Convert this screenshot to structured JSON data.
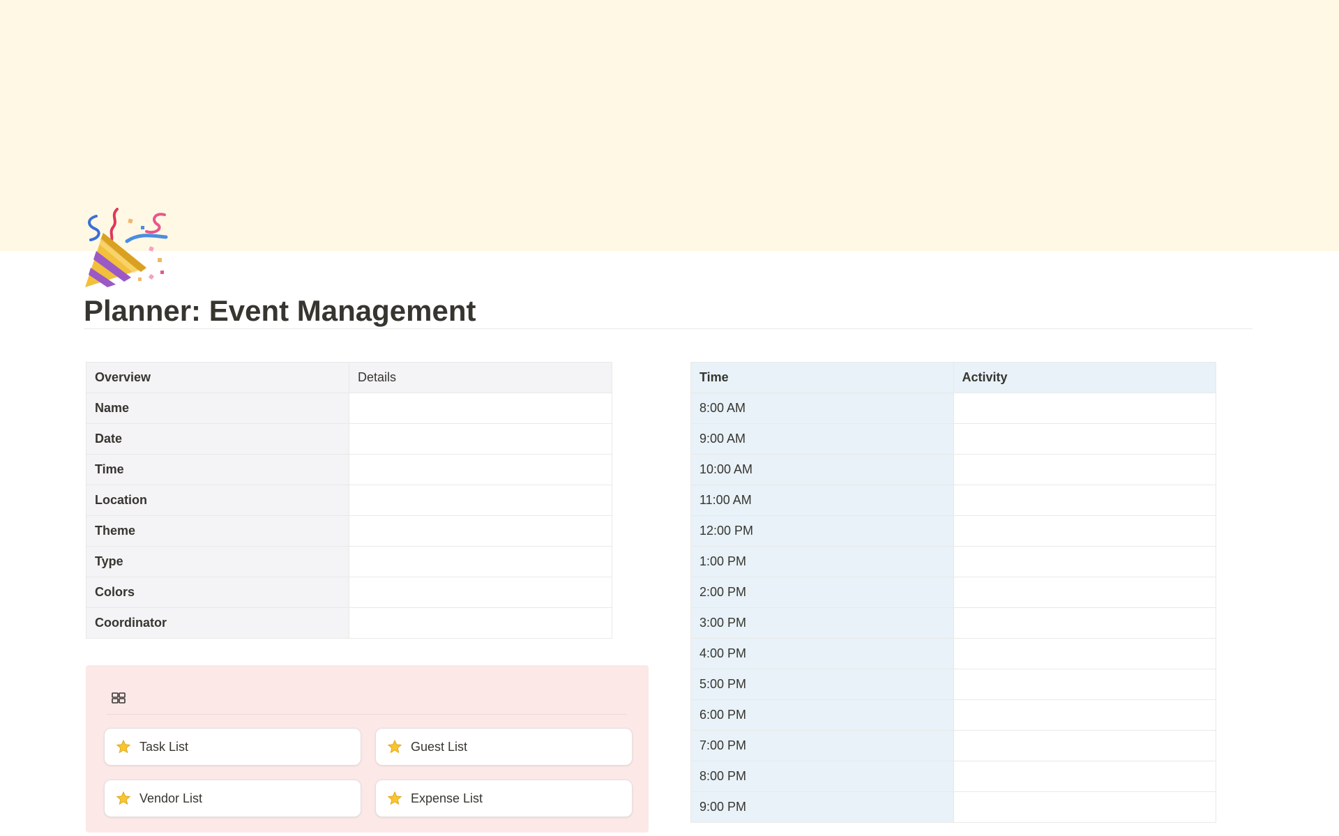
{
  "page": {
    "title": "Planner: Event Management",
    "icon": "party-popper-icon",
    "cover_color": "#fff8e4"
  },
  "overview_table": {
    "headers": [
      "Overview",
      "Details"
    ],
    "rows": [
      {
        "label": "Name",
        "value": ""
      },
      {
        "label": "Date",
        "value": ""
      },
      {
        "label": "Time",
        "value": ""
      },
      {
        "label": "Location",
        "value": ""
      },
      {
        "label": "Theme",
        "value": ""
      },
      {
        "label": "Type",
        "value": ""
      },
      {
        "label": "Colors",
        "value": ""
      },
      {
        "label": "Coordinator",
        "value": ""
      }
    ]
  },
  "schedule_table": {
    "headers": [
      "Time",
      "Activity"
    ],
    "rows": [
      {
        "time": "8:00 AM",
        "activity": ""
      },
      {
        "time": "9:00 AM",
        "activity": ""
      },
      {
        "time": "10:00 AM",
        "activity": ""
      },
      {
        "time": "11:00 AM",
        "activity": ""
      },
      {
        "time": "12:00 PM",
        "activity": ""
      },
      {
        "time": "1:00 PM",
        "activity": ""
      },
      {
        "time": "2:00 PM",
        "activity": ""
      },
      {
        "time": "3:00 PM",
        "activity": ""
      },
      {
        "time": "4:00 PM",
        "activity": ""
      },
      {
        "time": "5:00 PM",
        "activity": ""
      },
      {
        "time": "6:00 PM",
        "activity": ""
      },
      {
        "time": "7:00 PM",
        "activity": ""
      },
      {
        "time": "8:00 PM",
        "activity": ""
      },
      {
        "time": "9:00 PM",
        "activity": ""
      }
    ]
  },
  "links": {
    "header_icon": "gallery-view-icon",
    "background": "#fbe8e7",
    "items": [
      {
        "label": "Task List",
        "icon": "star-icon"
      },
      {
        "label": "Guest List",
        "icon": "star-icon"
      },
      {
        "label": "Vendor List",
        "icon": "star-icon"
      },
      {
        "label": "Expense List",
        "icon": "star-icon"
      }
    ]
  }
}
